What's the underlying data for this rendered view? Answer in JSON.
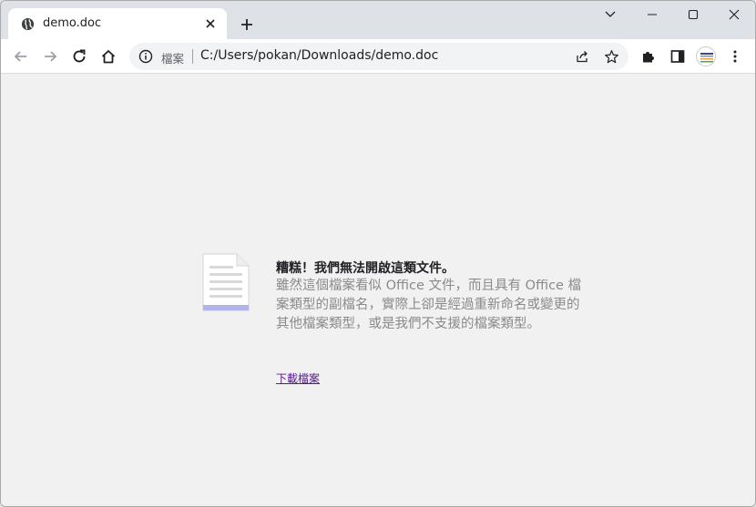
{
  "tab": {
    "title": "demo.doc",
    "favicon": "globe-icon",
    "close": "close-icon"
  },
  "window_controls": [
    "chevron-down-icon",
    "minimize-icon",
    "maximize-icon",
    "close-icon"
  ],
  "toolbar": {
    "back": "arrow-left-icon",
    "forward": "arrow-right-icon",
    "reload": "reload-icon",
    "home": "home-icon",
    "omnibox": {
      "site_label": "檔案",
      "url": "C:/Users/pokan/Downloads/demo.doc",
      "share": "share-icon",
      "bookmark": "star-icon"
    },
    "extensions": "puzzle-icon",
    "sidepanel": "sidepanel-icon",
    "menu": "more-vert-icon"
  },
  "error": {
    "title": "糟糕！我們無法開啟這類文件。",
    "body": "雖然這個檔案看似 Office 文件，而且具有 Office 檔案類型的副檔名，實際上卻是經過重新命名或變更的其他檔案類型，或是我們不支援的檔案類型。",
    "link": "下載檔案"
  },
  "colors": {
    "tabstrip": "#dee1e6",
    "content_bg": "#f1f1f1",
    "link": "#551a8b",
    "doc_accent": "#b4b3e8"
  }
}
